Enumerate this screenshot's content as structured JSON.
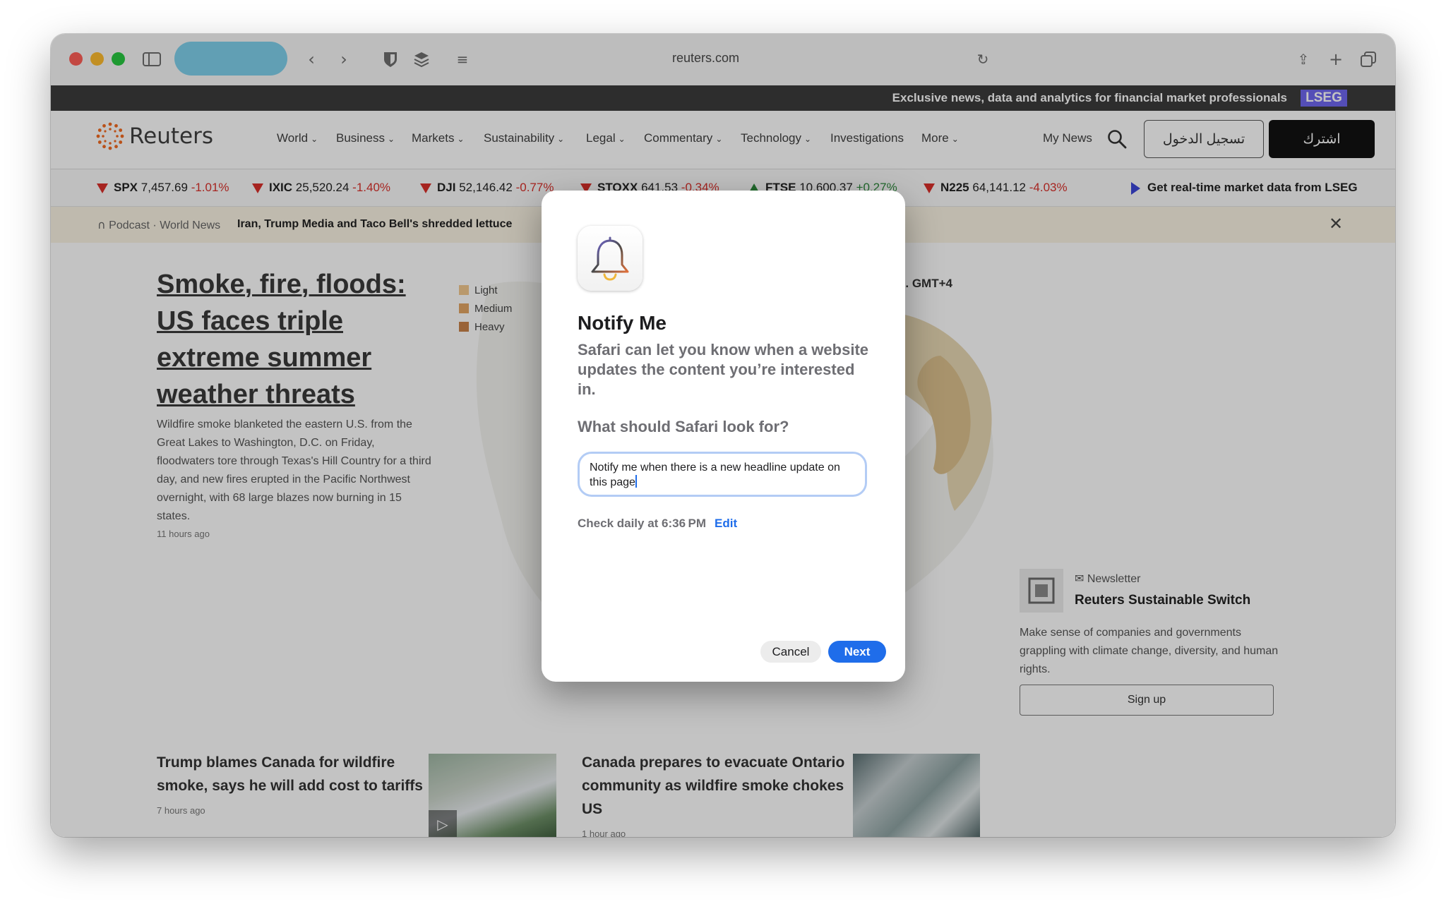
{
  "browser": {
    "url": "reuters.com"
  },
  "banner": {
    "text": "Exclusive news, data and analytics for financial market professionals",
    "badge": "LSEG"
  },
  "nav": {
    "logo": "Reuters",
    "items": [
      {
        "label": "World"
      },
      {
        "label": "Business"
      },
      {
        "label": "Markets"
      },
      {
        "label": "Sustainability"
      },
      {
        "label": "Legal"
      },
      {
        "label": "Commentary"
      },
      {
        "label": "Technology"
      },
      {
        "label": "Investigations"
      },
      {
        "label": "More"
      }
    ],
    "my_news": "My News",
    "login": "تسجيل الدخول",
    "subscribe": "اشترك"
  },
  "ticker": {
    "items": [
      {
        "symbol": "SPX",
        "value": "7,457.69",
        "change": "-1.01%",
        "dir": "down"
      },
      {
        "symbol": "IXIC",
        "value": "25,520.24",
        "change": "-1.40%",
        "dir": "down"
      },
      {
        "symbol": "DJI",
        "value": "52,146.42",
        "change": "-0.77%",
        "dir": "down"
      },
      {
        "symbol": "STOXX",
        "value": "641.53",
        "change": "-0.34%",
        "dir": "down"
      },
      {
        "symbol": "FTSE",
        "value": "10,600.37",
        "change": "+0.27%",
        "dir": "up"
      },
      {
        "symbol": "N225",
        "value": "64,141.12",
        "change": "-4.03%",
        "dir": "down"
      }
    ],
    "cta": "Get real-time market data from LSEG"
  },
  "podcast": {
    "meta": "Podcast · World News",
    "title": "Iran, Trump Media and Taco Bell's shredded lettuce"
  },
  "hero": {
    "title": "Smoke, fire, floods: US faces triple extreme summer weather threats",
    "body": "Wildfire smoke blanketed the eastern U.S. from the Great Lakes to Washington, D.C. on Friday, floodwaters tore through Texas's Hill Country for a third day, and new fires erupted in the Pacific Northwest overnight, with 68 large blazes now burning in 15 states.",
    "time": "11 hours ago"
  },
  "map": {
    "legend": [
      {
        "label": "Light",
        "color": "#f2c98f"
      },
      {
        "label": "Medium",
        "color": "#e3a564"
      },
      {
        "label": "Heavy",
        "color": "#c9824a"
      }
    ],
    "timestamp_fragment": "n. GMT+4"
  },
  "newsletter": {
    "label": "Newsletter",
    "title": "Reuters Sustainable Switch",
    "desc": "Make sense of companies and governments grappling with climate change, diversity, and human rights.",
    "button": "Sign up"
  },
  "stories": [
    {
      "title": "Trump blames Canada for wildfire smoke, says he will add cost to tariffs",
      "time": "7 hours ago"
    },
    {
      "title": "Canada prepares to evacuate Ontario community as wildfire smoke chokes US",
      "time": "1 hour ago"
    }
  ],
  "dialog": {
    "title": "Notify Me",
    "subtitle": "Safari can let you know when a website updates the content you’re interested in.",
    "question": "What should Safari look for?",
    "input_value": "Notify me when there is a new headline update on this page",
    "check": "Check daily at 6:36 PM",
    "edit": "Edit",
    "cancel": "Cancel",
    "next": "Next"
  },
  "colors": {
    "accent": "#1f6dea",
    "ticker_down": "#d9302a",
    "ticker_up": "#2d8a3b",
    "lseg": "#6e67f0"
  }
}
